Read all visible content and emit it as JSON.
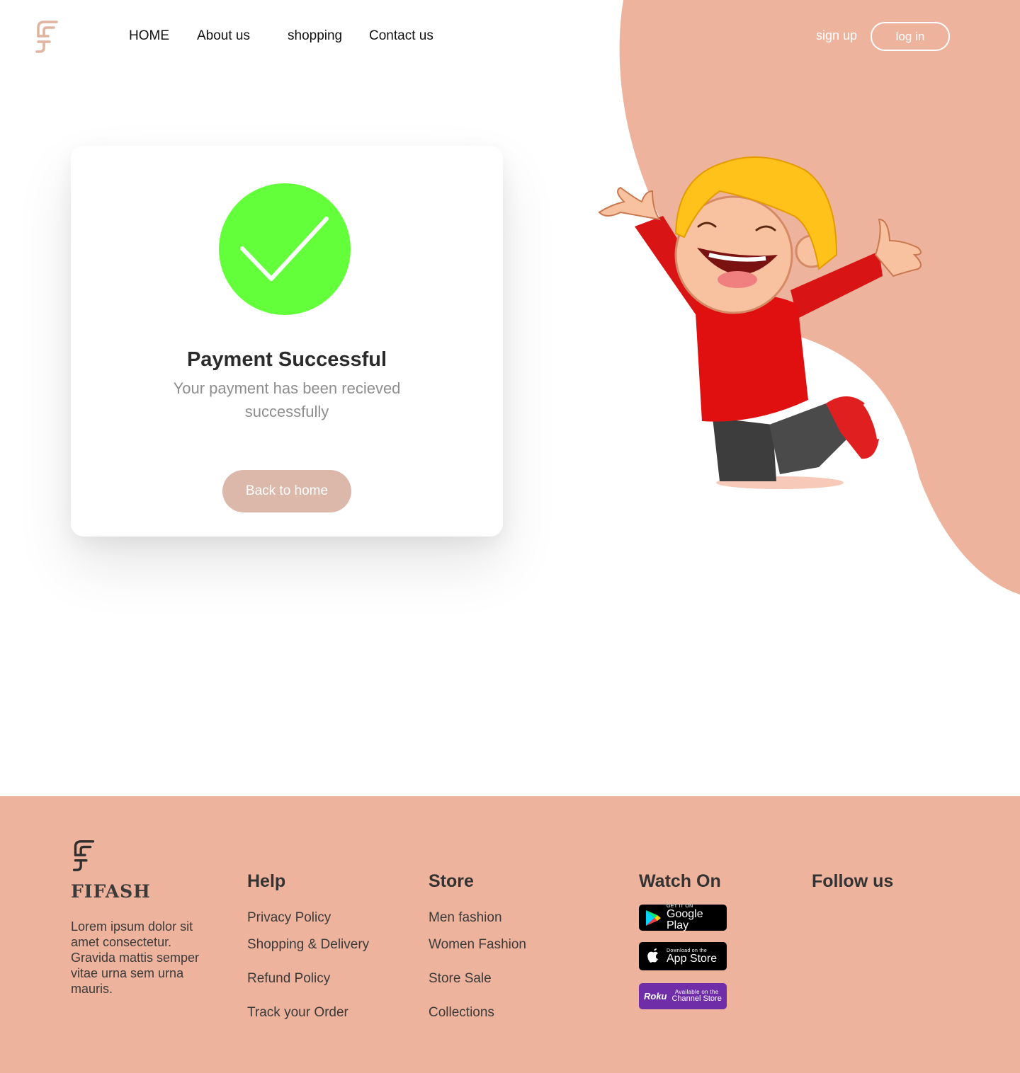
{
  "header": {
    "nav": [
      "HOME",
      "About us",
      "shopping",
      "Contact us"
    ],
    "signup_label": "sign up",
    "login_label": "log in"
  },
  "card": {
    "title": "Payment Successful",
    "message": "Your payment has been recieved successfully",
    "button_label": "Back to home"
  },
  "footer": {
    "brand": "FIFASH",
    "description": "Lorem ipsum dolor sit amet consectetur. Gravida mattis semper vitae urna sem urna mauris.",
    "help": {
      "heading": "Help",
      "links": [
        "Privacy Policy",
        "Shopping & Delivery",
        "Refund Policy",
        "Track your Order"
      ]
    },
    "store": {
      "heading": "Store",
      "links": [
        "Men fashion",
        "Women Fashion",
        "Store Sale",
        "Collections"
      ]
    },
    "watch": {
      "heading": "Watch On",
      "badges": [
        {
          "small": "GET IT ON",
          "big": "Google Play",
          "icon": "google-play-icon"
        },
        {
          "small": "Download on the",
          "big": "App Store",
          "icon": "apple-icon"
        },
        {
          "logo": "Roku",
          "small": "Available on the",
          "big": "Channel Store",
          "icon": "roku-icon"
        }
      ]
    },
    "follow": {
      "heading": "Follow us"
    }
  },
  "colors": {
    "accent": "#eeb39d",
    "success": "#63ff3a",
    "button": "#dcb8aa",
    "roku": "#6f2da8"
  }
}
